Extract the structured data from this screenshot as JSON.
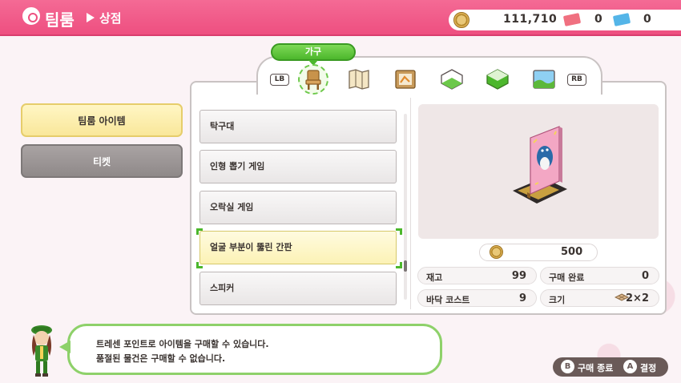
{
  "header": {
    "title": "팀룸",
    "subtitle": "상점"
  },
  "currency": {
    "coins": "111,710",
    "red_tickets": "0",
    "blue_tickets": "0"
  },
  "sidebar": {
    "items": [
      {
        "label": "팀룸 아이템",
        "active": true
      },
      {
        "label": "티켓",
        "active": false
      }
    ]
  },
  "category": {
    "selected_label": "가구",
    "lb": "LB",
    "rb": "RB",
    "icons": [
      "chair-icon",
      "map-icon",
      "frame-icon",
      "floor-icon",
      "wall-icon",
      "window-icon"
    ]
  },
  "items": [
    {
      "label": "탁구대",
      "selected": false
    },
    {
      "label": "인형 뽑기 게임",
      "selected": false
    },
    {
      "label": "오락실 게임",
      "selected": false
    },
    {
      "label": "얼굴 부분이 뚫린 간판",
      "selected": true
    },
    {
      "label": "스피커",
      "selected": false
    }
  ],
  "detail": {
    "price": "500",
    "stock_label": "재고",
    "stock_value": "99",
    "purchased_label": "구매 완료",
    "purchased_value": "0",
    "floor_cost_label": "바닥 코스트",
    "floor_cost_value": "9",
    "size_label": "크기",
    "size_value": "2×2"
  },
  "message": {
    "line1": "트레센 포인트로 아이템을 구매할 수 있습니다.",
    "line2": "품절된 물건은 구매할 수 없습니다."
  },
  "controls": {
    "b_glyph": "B",
    "b_label": "구매 종료",
    "a_glyph": "A",
    "a_label": "결정"
  },
  "colors": {
    "header_pink": "#ee4f80",
    "accent_green": "#4cb72c",
    "selected_yellow": "#fcf2b5"
  }
}
